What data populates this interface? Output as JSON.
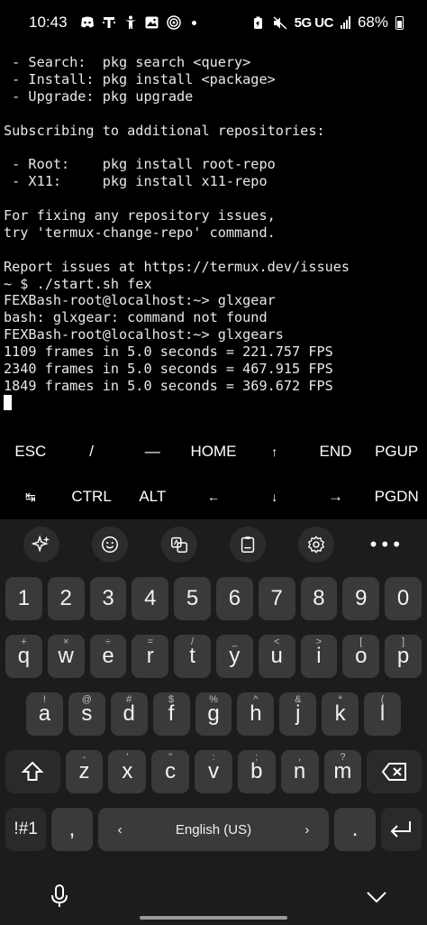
{
  "status_bar": {
    "time": "10:43",
    "icons": [
      "discord-icon",
      "tmobile-icon",
      "accessibility-icon",
      "gallery-icon",
      "wifi-call-icon"
    ],
    "network": "5G UC",
    "battery": "68%"
  },
  "terminal": {
    "lines": [
      " - Search:  pkg search <query>",
      " - Install: pkg install <package>",
      " - Upgrade: pkg upgrade",
      "",
      "Subscribing to additional repositories:",
      "",
      " - Root:    pkg install root-repo",
      " - X11:     pkg install x11-repo",
      "",
      "For fixing any repository issues,",
      "try 'termux-change-repo' command.",
      "",
      "Report issues at https://termux.dev/issues",
      "~ $ ./start.sh fex",
      "FEXBash-root@localhost:~> glxgear",
      "bash: glxgear: command not found",
      "FEXBash-root@localhost:~> glxgears",
      "1109 frames in 5.0 seconds = 221.757 FPS",
      "2340 frames in 5.0 seconds = 467.915 FPS",
      "1849 frames in 5.0 seconds = 369.672 FPS"
    ]
  },
  "extra_keys": {
    "row1": [
      "ESC",
      "/",
      "—",
      "HOME",
      "↑",
      "END",
      "PGUP"
    ],
    "row2": [
      "↹",
      "CTRL",
      "ALT",
      "←",
      "↓",
      "→",
      "PGDN"
    ]
  },
  "keyboard": {
    "toolbar": [
      "ai-sparkle-icon",
      "emoji-icon",
      "translate-icon",
      "clipboard-icon",
      "settings-icon",
      "more-icon"
    ],
    "numbers": [
      "1",
      "2",
      "3",
      "4",
      "5",
      "6",
      "7",
      "8",
      "9",
      "0"
    ],
    "row_q": [
      {
        "key": "q",
        "hint": "+"
      },
      {
        "key": "w",
        "hint": "×"
      },
      {
        "key": "e",
        "hint": "÷"
      },
      {
        "key": "r",
        "hint": "="
      },
      {
        "key": "t",
        "hint": "/"
      },
      {
        "key": "y",
        "hint": "_"
      },
      {
        "key": "u",
        "hint": "<"
      },
      {
        "key": "i",
        "hint": ">"
      },
      {
        "key": "o",
        "hint": "["
      },
      {
        "key": "p",
        "hint": "]"
      }
    ],
    "row_a": [
      {
        "key": "a",
        "hint": "!"
      },
      {
        "key": "s",
        "hint": "@"
      },
      {
        "key": "d",
        "hint": "#"
      },
      {
        "key": "f",
        "hint": "$"
      },
      {
        "key": "g",
        "hint": "%"
      },
      {
        "key": "h",
        "hint": "^"
      },
      {
        "key": "j",
        "hint": "&"
      },
      {
        "key": "k",
        "hint": "*"
      },
      {
        "key": "l",
        "hint": "("
      }
    ],
    "row_z": [
      {
        "key": "z",
        "hint": "-"
      },
      {
        "key": "x",
        "hint": "'"
      },
      {
        "key": "c",
        "hint": "\""
      },
      {
        "key": "v",
        "hint": ":"
      },
      {
        "key": "b",
        "hint": ";"
      },
      {
        "key": "n",
        "hint": ","
      },
      {
        "key": "m",
        "hint": "?"
      }
    ],
    "symbols_label": "!#1",
    "comma": ",",
    "space_label": "English (US)",
    "period": "."
  }
}
